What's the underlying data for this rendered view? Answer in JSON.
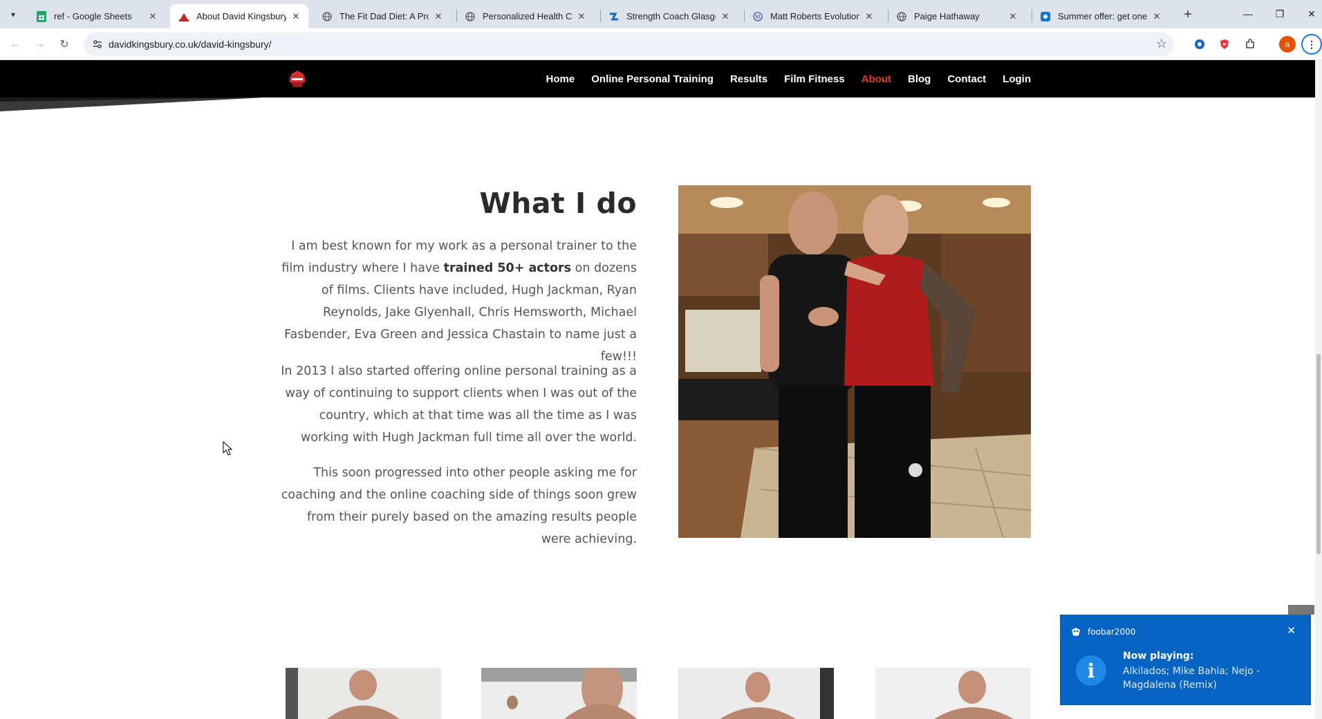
{
  "browser": {
    "tabs": [
      {
        "title": "ref - Google Sheets",
        "icon": "google-sheets-icon"
      },
      {
        "title": "About David Kingsbury | C",
        "icon": "kingsbury-site-icon",
        "active": true
      },
      {
        "title": "The Fit Dad Diet: A Prover",
        "icon": "globe-icon"
      },
      {
        "title": "Personalized Health Coac",
        "icon": "globe-icon"
      },
      {
        "title": "Strength Coach Glasgow",
        "icon": "strength-coach-icon"
      },
      {
        "title": "Matt Roberts Evolution | Y",
        "icon": "matt-roberts-icon"
      },
      {
        "title": "Paige Hathaway",
        "icon": "globe-icon"
      },
      {
        "title": "Summer offer: get one m",
        "icon": "offer-site-icon"
      }
    ],
    "url": "davidkingsbury.co.uk/david-kingsbury/",
    "profile_initial": "a"
  },
  "site": {
    "nav": [
      "Home",
      "Online Personal Training",
      "Results",
      "Film Fitness",
      "About",
      "Blog",
      "Contact",
      "Login"
    ],
    "active_nav": "About",
    "accent": "#e0392f"
  },
  "section": {
    "title": "What I do",
    "p1_before": "I am best known for my work as a personal trainer to the film industry where I have ",
    "p1_bold": "trained 50+ actors",
    "p1_after": " on dozens of films. Clients have included, Hugh Jackman, Ryan Reynolds, Jake Glyenhall, Chris Hemsworth, Michael Fasbender, Eva Green and Jessica Chastain to name just a few!!!",
    "p2": "In 2013 I also started offering online personal training as a way of continuing to support clients when I was out of the country, which at that time was all the time as I was working with Hugh Jackman full time all over the world.",
    "p3": "This soon progressed into other people asking me for coaching and the online coaching side of things soon grew from their purely based on the amazing results people were achieving."
  },
  "toast": {
    "app": "foobar2000",
    "heading": "Now playing:",
    "body": "Alkilados; Mike Bahia; Nejo - Magdalena (Remix)",
    "color": "#0563c1"
  }
}
